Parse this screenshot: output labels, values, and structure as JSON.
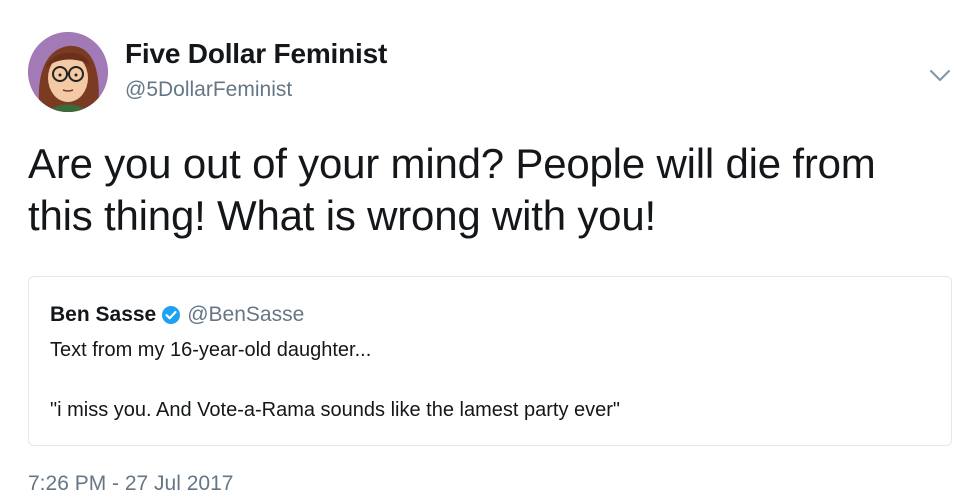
{
  "author": {
    "display_name": "Five Dollar Feminist",
    "handle": "@5DollarFeminist",
    "avatar_icon": "cartoon-avatar-icon"
  },
  "tweet": {
    "text": "Are you out of your mind? People will die from this thing! What is wrong with you!",
    "timestamp": "7:26 PM - 27 Jul 2017"
  },
  "quoted_tweet": {
    "display_name": "Ben Sasse",
    "handle": "@BenSasse",
    "verified_icon": "verified-badge-icon",
    "line1": "Text from my 16-year-old daughter...",
    "line2": "\"i miss you. And Vote-a-Rama sounds like the lamest party ever\""
  },
  "colors": {
    "text_primary": "#14171a",
    "text_secondary": "#657786",
    "verified_blue": "#1da1f2",
    "border": "#e1e8ed"
  }
}
